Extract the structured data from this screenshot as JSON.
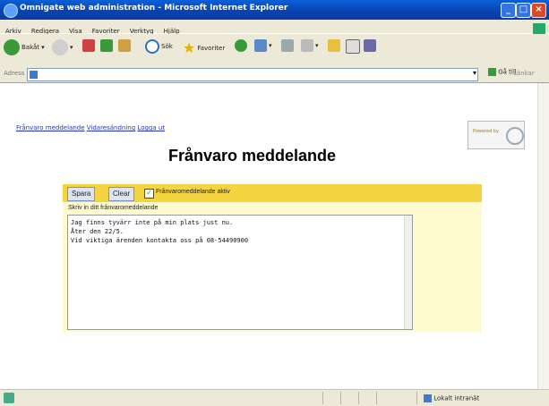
{
  "window": {
    "title": "Omnigate web administration - Microsoft Internet Explorer"
  },
  "menubar": {
    "items": [
      "Arkiv",
      "Redigera",
      "Visa",
      "Favoriter",
      "Verktyg",
      "Hjälp"
    ]
  },
  "toolbar": {
    "back_label": "Bakåt",
    "search_label": "Sök",
    "favorites_label": "Favoriter"
  },
  "address_bar": {
    "label": "Adress",
    "value": "",
    "go_label": "Gå till",
    "links_label": "Länkar"
  },
  "page": {
    "powered_by": "Powered by",
    "nav": {
      "link1": "Frånvaro meddelande",
      "link2": "Vidaresändning",
      "link3": "Logga ut"
    },
    "heading": "Frånvaro meddelande",
    "form": {
      "save_label": "Spara",
      "clear_label": "Clear",
      "active_checkbox_label": "Frånvaromeddelande aktiv",
      "active_checked": true,
      "prompt": "Skriv in ditt frånvaromeddelande",
      "message": "Jag finns tyvärr inte på min plats just nu.\nÅter den 22/5.\nVid viktiga ärenden kontakta oss på 08-54490900"
    }
  },
  "statusbar": {
    "zone": "Lokalt intranät"
  },
  "colors": {
    "titlebar": "#0842b0",
    "form_header": "#f5d442",
    "form_bg": "#fefbd0",
    "link": "#2233cc"
  }
}
